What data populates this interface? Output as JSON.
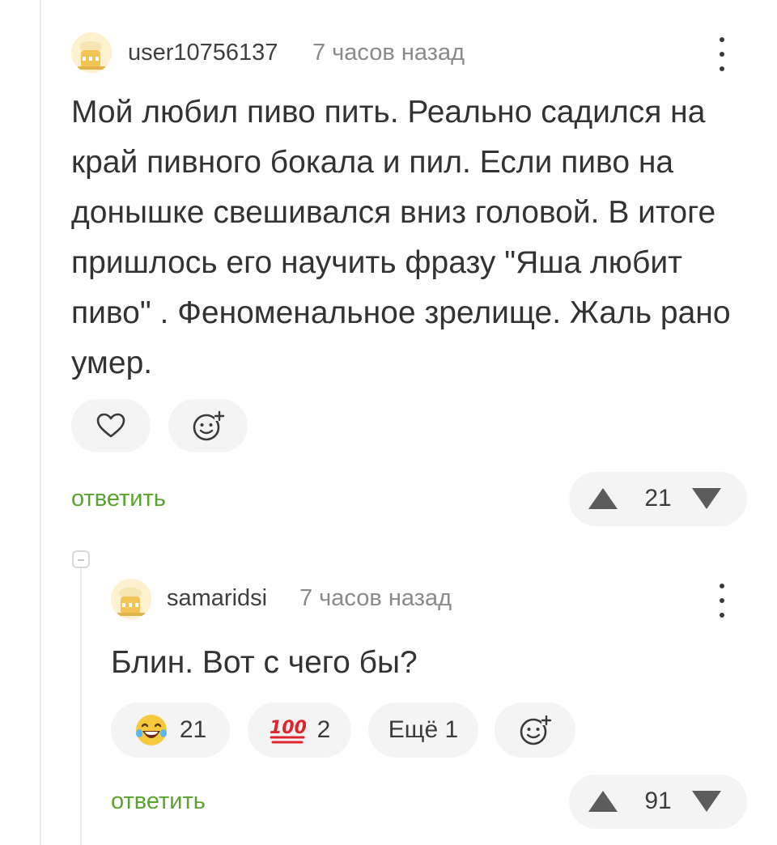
{
  "comments": [
    {
      "username": "user10756137",
      "time": "7 часов назад",
      "avatar_icon": "cartoon-avatar-icon",
      "text": "Мой любил пиво пить. Реально садился на край пивного бокала и пил. Если пиво на донышке свешивался вниз головой. В итоге пришлось его научить фразу \"Яша любит пиво\" . Феноменальное зрелище. Жаль рано умер.",
      "reactions": {
        "like_icon": "heart-icon",
        "add_reaction_icon": "smiley-plus-icon"
      },
      "reply_label": "ответить",
      "rating": "21"
    },
    {
      "username": "samaridsi",
      "time": "7 часов назад",
      "avatar_icon": "cartoon-avatar-icon",
      "text": "Блин. Вот с чего бы?",
      "reactions": {
        "items": [
          {
            "icon": "laughing-face-icon",
            "count": "21"
          },
          {
            "icon": "hundred-points-icon",
            "count": "2"
          }
        ],
        "more_label": "Ещё 1",
        "add_reaction_icon": "smiley-plus-icon"
      },
      "reply_label": "ответить",
      "rating": "91"
    }
  ],
  "colors": {
    "accent_green": "#59a331",
    "pill_bg": "#f4f4f4",
    "muted_text": "#8a8a8a"
  }
}
